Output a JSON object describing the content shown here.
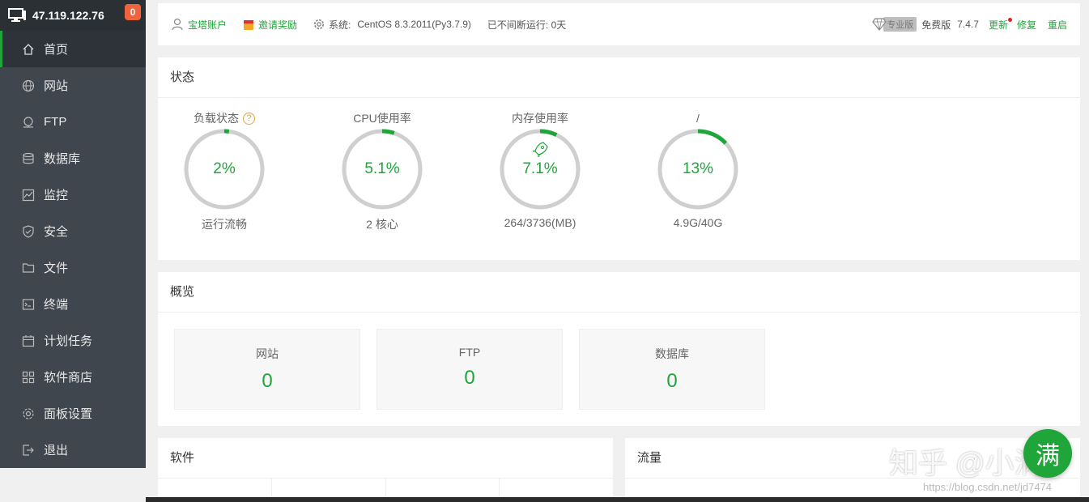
{
  "sidebar": {
    "ip": "47.119.122.76",
    "badge": "0",
    "items": [
      {
        "label": "首页",
        "icon": "home-icon"
      },
      {
        "label": "网站",
        "icon": "globe-icon"
      },
      {
        "label": "FTP",
        "icon": "ftp-icon"
      },
      {
        "label": "数据库",
        "icon": "database-icon"
      },
      {
        "label": "监控",
        "icon": "monitor-chart-icon"
      },
      {
        "label": "安全",
        "icon": "shield-icon"
      },
      {
        "label": "文件",
        "icon": "folder-icon"
      },
      {
        "label": "终端",
        "icon": "terminal-icon"
      },
      {
        "label": "计划任务",
        "icon": "calendar-icon"
      },
      {
        "label": "软件商店",
        "icon": "grid-icon"
      },
      {
        "label": "面板设置",
        "icon": "gear-icon"
      },
      {
        "label": "退出",
        "icon": "logout-icon"
      }
    ]
  },
  "header": {
    "account": "宝塔账户",
    "invite": "邀请奖励",
    "system_label": "系统:",
    "system_value": "CentOS 8.3.2011(Py3.7.9)",
    "uptime": "已不间断运行: 0天",
    "pro_tag": "专业版",
    "edition": "免费版",
    "version": "7.4.7",
    "update": "更新",
    "repair": "修复",
    "restart": "重启"
  },
  "status": {
    "title": "状态",
    "gauges": [
      {
        "label": "负载状态",
        "value": "2%",
        "percent": 2,
        "sub": "运行流畅"
      },
      {
        "label": "CPU使用率",
        "value": "5.1%",
        "percent": 5.1,
        "sub": "2 核心"
      },
      {
        "label": "内存使用率",
        "value": "7.1%",
        "percent": 7.1,
        "sub": "264/3736(MB)"
      },
      {
        "label": "/",
        "value": "13%",
        "percent": 13,
        "sub": "4.9G/40G"
      }
    ]
  },
  "overview": {
    "title": "概览",
    "boxes": [
      {
        "label": "网站",
        "value": "0"
      },
      {
        "label": "FTP",
        "value": "0"
      },
      {
        "label": "数据库",
        "value": "0"
      }
    ]
  },
  "software": {
    "title": "软件"
  },
  "traffic": {
    "title": "流量"
  },
  "watermark": {
    "text": "知乎 @小满",
    "fab": "满",
    "csdn": "https://blog.csdn.net/jd7474"
  },
  "colors": {
    "accent": "#20a53a",
    "sidebar": "#3f464d",
    "badge": "#f0643d"
  }
}
